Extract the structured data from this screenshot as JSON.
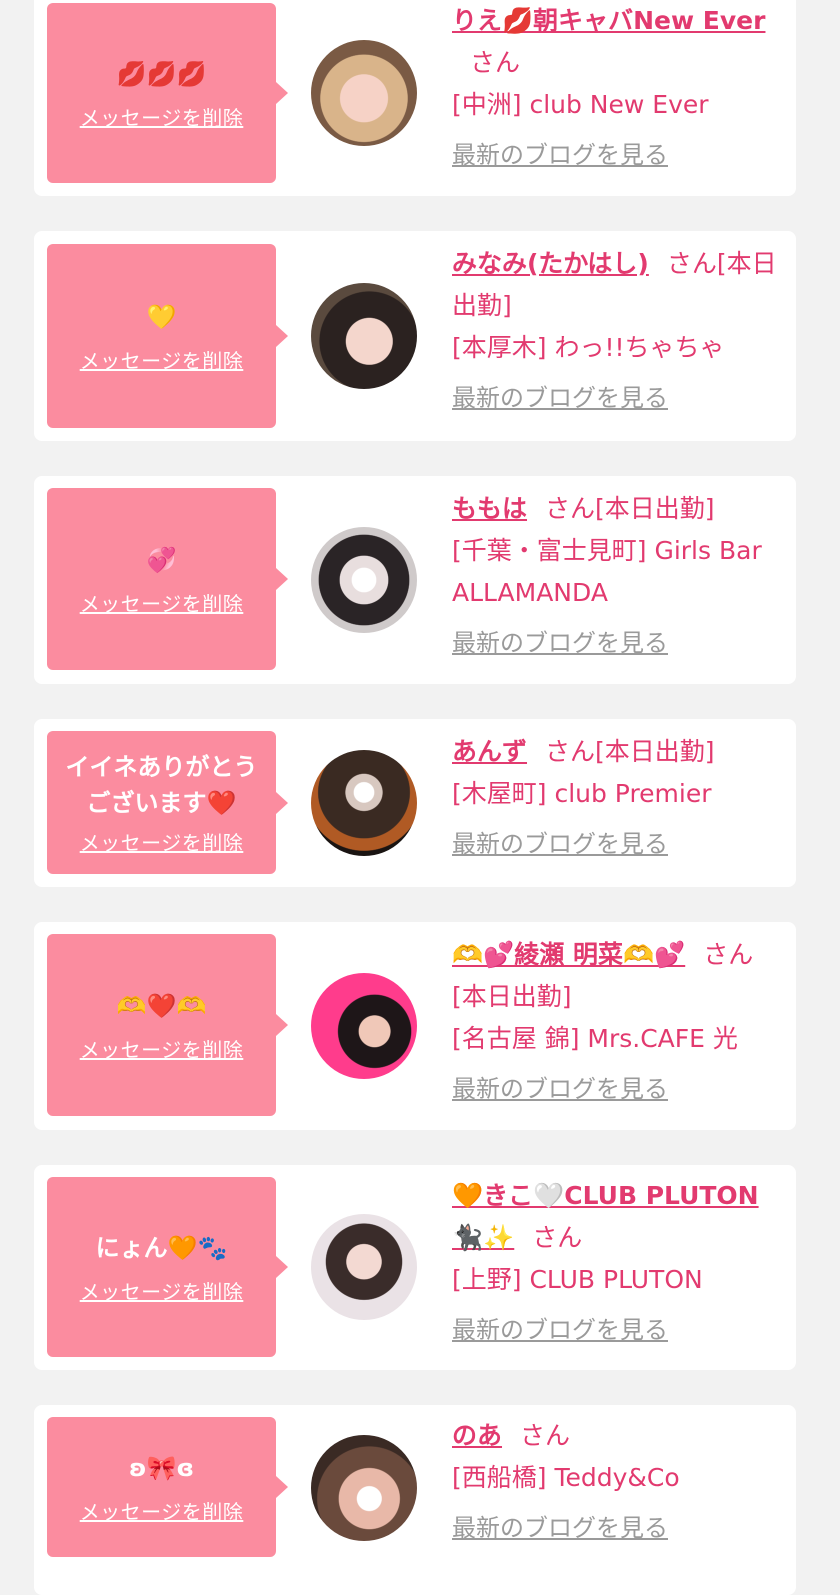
{
  "delete_label": "メッセージを削除",
  "blog_label": "最新のブログを見る",
  "san_label": "さん",
  "colors": {
    "accent": "#e23a6f",
    "bubble": "#fb8c9f",
    "background": "#f2f2f2"
  },
  "cards": [
    {
      "message": "💋💋💋",
      "name": "りえ💋朝キャバNew Ever",
      "status": "",
      "shop": "[中洲] club New Ever"
    },
    {
      "message": "💛",
      "name": "みなみ(たかはし)",
      "status": "[本日出勤]",
      "shop": "[本厚木] わっ!!ちゃちゃ"
    },
    {
      "message": "💞",
      "name": "ももは",
      "status": "[本日出勤]",
      "shop": "[千葉・富士見町] Girls Bar ALLAMANDA"
    },
    {
      "message": "イイネありがとうございます❤️",
      "name": "あんず",
      "status": "[本日出勤]",
      "shop": "[木屋町] club Premier"
    },
    {
      "message": "🫶❤️🫶",
      "name": "🫶💕綾瀬 明菜🫶💕",
      "status": "[本日出勤]",
      "shop": "[名古屋 錦] Mrs.CAFE 光"
    },
    {
      "message": "にょん🧡🐾",
      "name": "🧡きこ🤍CLUB PLUTON 🐈‍⬛✨",
      "status": "",
      "shop": "[上野] CLUB PLUTON"
    },
    {
      "message": "ʚ🎀ɞ",
      "name": "のあ",
      "status": "",
      "shop": "[西船橋] Teddy&Co"
    }
  ]
}
